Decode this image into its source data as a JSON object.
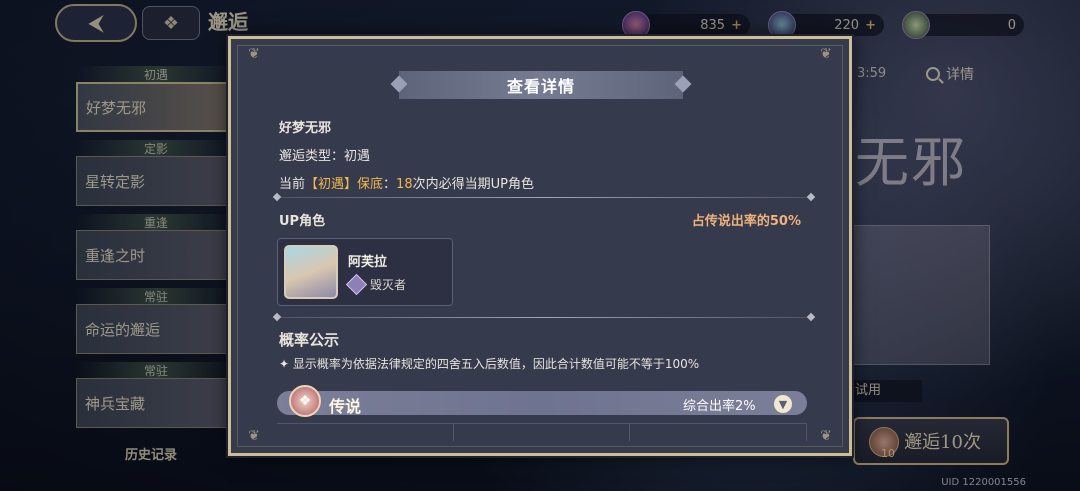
{
  "topbar": {
    "back_icon": "back-arrow-icon",
    "home_icon": "grid-menu-icon",
    "title": "邂逅",
    "currencies": [
      {
        "icon": "gem-icon",
        "value": "835",
        "plus": "+"
      },
      {
        "icon": "crystal-icon",
        "value": "220",
        "plus": "+"
      },
      {
        "icon": "token-icon",
        "value": "0"
      }
    ]
  },
  "left_nav": {
    "items": [
      {
        "category": "初遇",
        "label": "好梦无邪",
        "active": true
      },
      {
        "category": "定影",
        "label": "星转定影"
      },
      {
        "category": "重逢",
        "label": "重逢之时"
      },
      {
        "category": "常驻",
        "label": "命运的邂逅"
      },
      {
        "category": "常驻",
        "label": "神兵宝藏"
      }
    ],
    "history": "历史记录"
  },
  "right_panel": {
    "timer": "3:59",
    "detail": "详情",
    "banner_title": "无邪",
    "try_label": "试用",
    "pull10": "邂逅10次",
    "pull10_count": "10",
    "uid": "UID 1220001556"
  },
  "modal": {
    "title": "查看详情",
    "banner_name": "好梦无邪",
    "type_label": "邂逅类型：初遇",
    "pity_prefix": "当前",
    "pity_tag": "【初遇】保底",
    "pity_colon": "：",
    "pity_count": "18",
    "pity_suffix": "次内必得当期UP角色",
    "up_section": "UP角色",
    "up_share": "占传说出率的50%",
    "character": {
      "name": "阿芙拉",
      "class_icon": "class-diamond-icon",
      "class": "毁灭者"
    },
    "prob_section": "概率公示",
    "prob_note": "✦ 显示概率为依据法律规定的四舍五入后数值，因此合计数值可能不等于100%",
    "legend": {
      "label": "传说",
      "rate": "综合出率2%",
      "toggle_icon": "chevron-down-icon"
    }
  },
  "colors": {
    "accent_gold": "#f2b84b",
    "frame": "#cdbd95",
    "panel": "#353a4d"
  }
}
